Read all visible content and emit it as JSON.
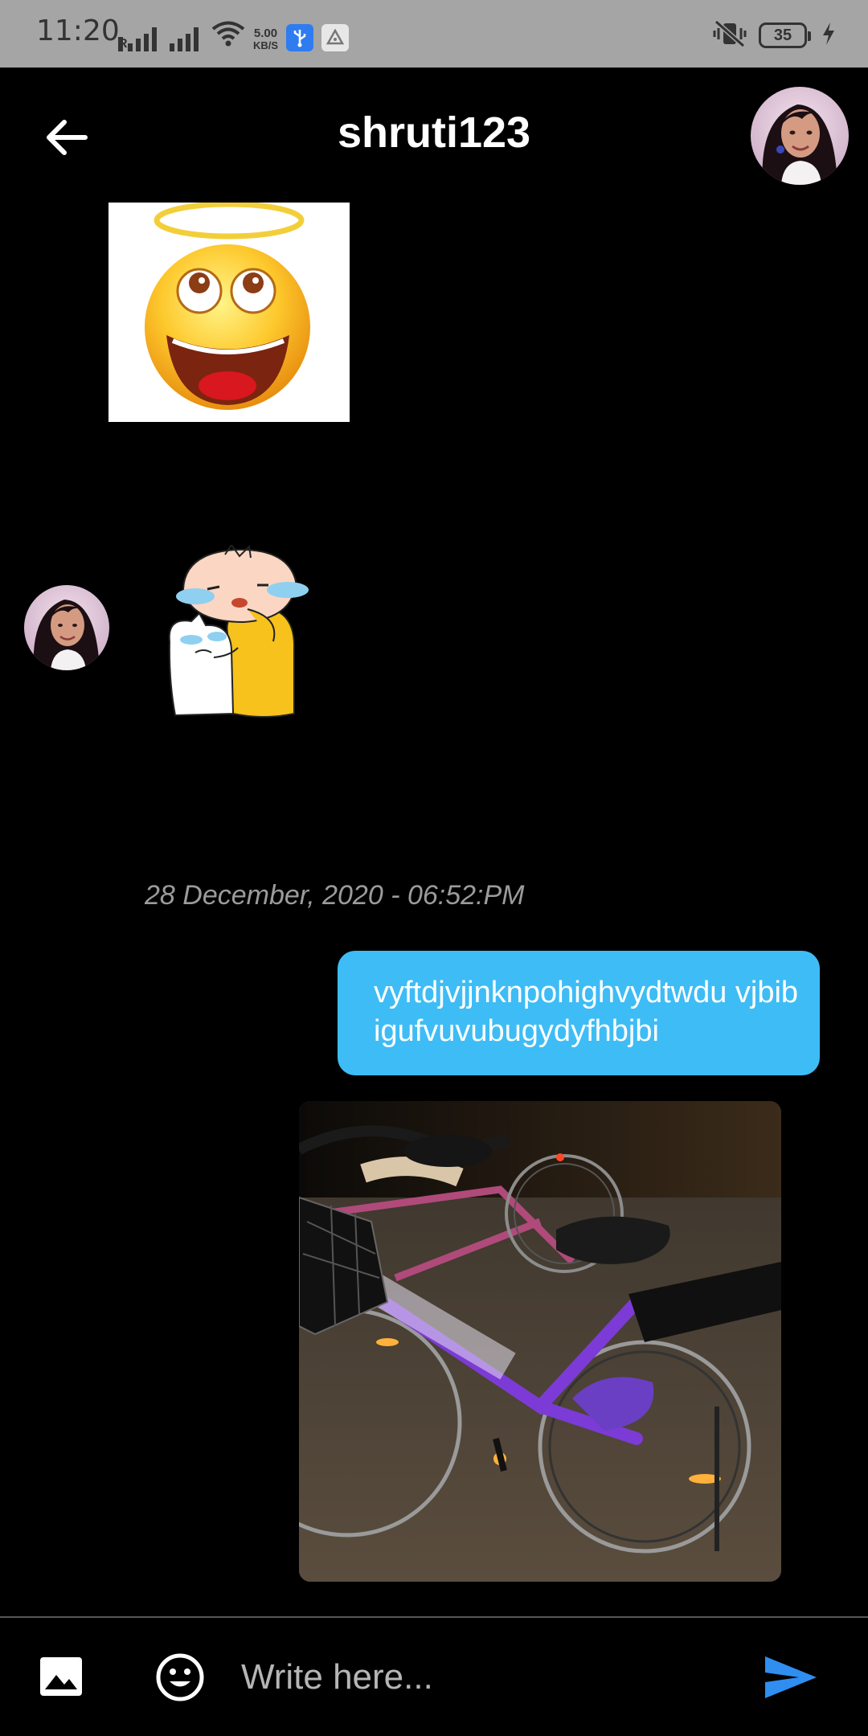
{
  "status_bar": {
    "time": "11:20",
    "network_speed_value": "5.00",
    "network_speed_unit": "KB/S",
    "battery_level": "35",
    "icons": [
      "signal-r-icon",
      "signal-icon",
      "wifi-icon",
      "usb-icon",
      "nav-icon",
      "vibrate-icon",
      "battery-icon",
      "charging-icon"
    ]
  },
  "header": {
    "title": "shruti123",
    "back_icon": "arrow-left-icon"
  },
  "messages": {
    "timestamp": "28 December, 2020 - 06:52:PM",
    "sent_text": "vyftdjvjjnknpohighvydtwdu vjbibigufvuvubugydyfhbjbi"
  },
  "input_bar": {
    "placeholder": "Write here...",
    "value": ""
  },
  "colors": {
    "background": "#000000",
    "accent": "#3ebcf6",
    "send": "#2f8ef0",
    "status_bar": "#a5a5a5"
  }
}
